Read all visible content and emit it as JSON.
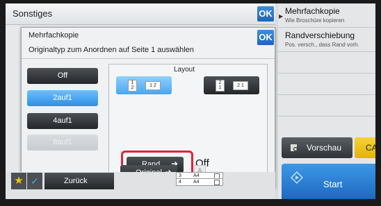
{
  "background": {
    "title": "Sonstiges",
    "ok_label": "OK"
  },
  "right_panel": {
    "items": [
      {
        "title": "Mehrfachkopie",
        "sub": "Wie Broschüre kopieren"
      },
      {
        "title": "Randverschiebung",
        "sub": "Pos. versch., dass Rand vorh."
      }
    ],
    "preview_label": "Vorschau",
    "ca_label": "CA",
    "start_label": "Start"
  },
  "dialog": {
    "title": "Mehrfachkopie",
    "ok_label": "OK",
    "instruction": "Originaltyp zum Anordnen auf Seite 1 auswählen",
    "options": [
      {
        "label": "Off",
        "state": "normal"
      },
      {
        "label": "2auf1",
        "state": "selected"
      },
      {
        "label": "4auf1",
        "state": "normal"
      },
      {
        "label": "8auf1",
        "state": "disabled"
      }
    ],
    "layout_label": "Layout",
    "layout_options": [
      {
        "pages": [
          "1",
          "2"
        ],
        "orientation": "vertical",
        "state": "selected"
      },
      {
        "pages": [
          "1",
          "2"
        ],
        "orientation": "horizontal",
        "state": "selected"
      },
      {
        "pages": [
          "2",
          "1"
        ],
        "orientation": "vertical",
        "state": "normal"
      },
      {
        "pages": [
          "2",
          "1"
        ],
        "orientation": "horizontal",
        "state": "normal"
      }
    ],
    "border_button_label": "Rand",
    "border_value": "Off",
    "original_button_label": "Original",
    "a_icon_label": "A"
  },
  "bottom_bar": {
    "back_label": "Zurück",
    "trays": [
      {
        "number": "3",
        "size": "A4"
      },
      {
        "number": "4",
        "size": "A4"
      }
    ]
  },
  "colors": {
    "accent_blue": "#2f8fe3",
    "highlight_red": "#e0233b",
    "ca_yellow": "#e2b400"
  }
}
